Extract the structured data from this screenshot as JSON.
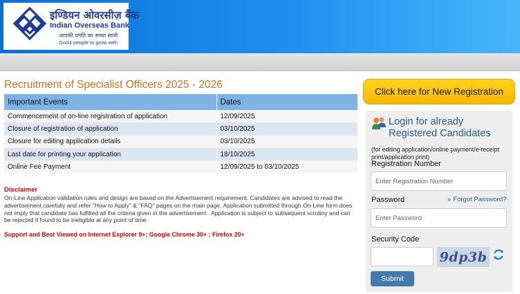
{
  "bank": {
    "name_hindi": "इण्डियन ओवरसीज़ बैंक",
    "name_english": "Indian Overseas Bank",
    "tagline_hindi": "आपकी प्रगति का सच्चा साथी",
    "tagline_english": "Good people to grow with",
    "logo_icon": "iob-logo-icon",
    "brand_color": "#1d3d99"
  },
  "main": {
    "title": "Recruitment of Specialist Officers 2025 - 2026",
    "table": {
      "headers": [
        "Important Events",
        "Dates"
      ],
      "rows": [
        {
          "event": "Commencement of on-line registration of application",
          "date": "12/09/2025"
        },
        {
          "event": "Closure of registration of application",
          "date": "03/10/2025"
        },
        {
          "event": "Closure for editing application details",
          "date": "03/10/2025"
        },
        {
          "event": "Last date for printing your application",
          "date": "18/10/2025"
        },
        {
          "event": "Online Fee Payment",
          "date": "12/09/2025 to 03/10/2025"
        }
      ]
    },
    "disclaimer_title": "Disclaimer",
    "disclaimer_text": "On-Line Application validation rules and design are based on the Advertisement requirement. Candidates are advised to read the advertisement carefully and refer \"How to Apply\" & \"FAQ\" pages on the main page. Application submitted through On-Line form does not imply that candidate has fulfilled all the criteria given in the advertisement . Application is subject to subsequent scrutiny and can be rejected if found to be ineligible at any point of time.",
    "support_text": "Support and Best Viewed on Internet Explorer 9+; Google Chrome 30+ ; Firefox 20+"
  },
  "sidebar": {
    "new_registration_label": "Click here for New Registration",
    "login_title_line1": "Login for already",
    "login_title_line2": "Registered Candidates",
    "login_note": "(for editing application/online payment/e-receipt print/application print)",
    "registration_label": "Registration Number",
    "registration_placeholder": "Enter Registration Number",
    "password_label": "Password",
    "password_placeholder": "Enter Password",
    "forgot_label": "Forgot Password?",
    "security_label": "Security Code",
    "captcha_text": "9dp3b",
    "submit_label": "Submit",
    "icons": [
      "users-icon",
      "chevron-double-right-icon",
      "refresh-icon"
    ],
    "accent_color": "#f7b800"
  }
}
